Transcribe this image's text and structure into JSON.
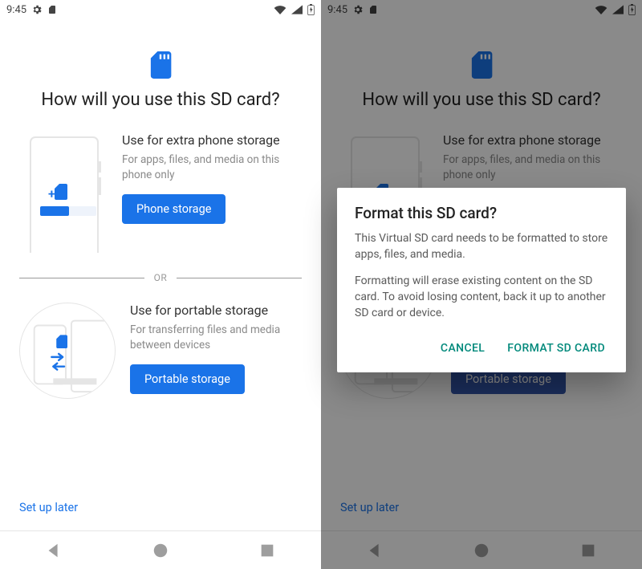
{
  "status": {
    "time": "9:45"
  },
  "colors": {
    "accent": "#1a73e8",
    "accent_dim": "#3355aa",
    "dialog_action": "#00897b"
  },
  "page": {
    "title": "How will you use this SD card?",
    "divider_text": "OR",
    "setup_later": "Set up later"
  },
  "options": {
    "phone_storage": {
      "title": "Use for extra phone storage",
      "desc": "For apps, files, and media on this phone only",
      "button": "Phone storage"
    },
    "portable_storage": {
      "title": "Use for portable storage",
      "desc": "For transferring files and media between devices",
      "button": "Portable storage"
    }
  },
  "dialog": {
    "title": "Format this SD card?",
    "body1": "This Virtual SD card needs to be formatted to store apps, files, and media.",
    "body2": "Formatting will erase existing content on the SD card. To avoid losing content, back it up to another SD card or device.",
    "cancel": "CANCEL",
    "confirm": "FORMAT SD CARD"
  }
}
